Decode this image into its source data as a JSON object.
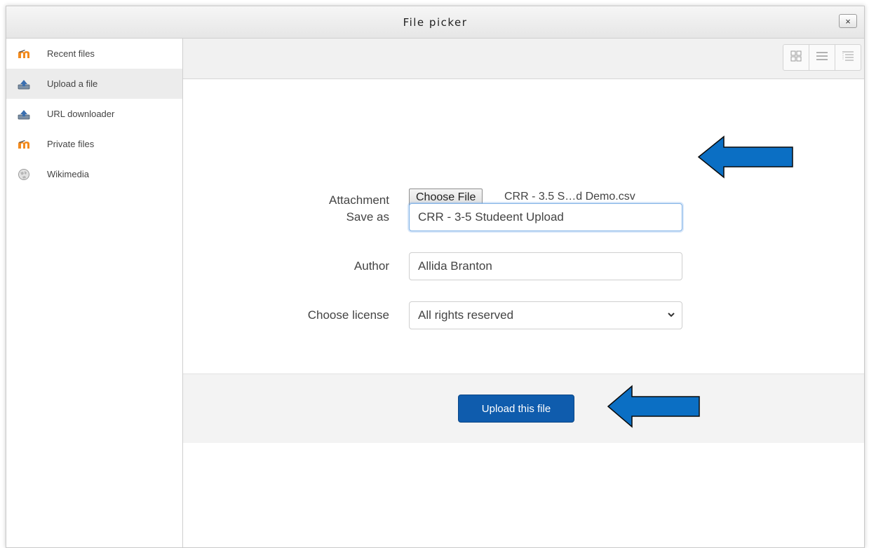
{
  "dialog": {
    "title": "File picker",
    "close_label": "×"
  },
  "sidebar": {
    "items": [
      {
        "label": "Recent files",
        "icon": "moodle-icon",
        "active": false
      },
      {
        "label": "Upload a file",
        "icon": "upload-icon",
        "active": true
      },
      {
        "label": "URL downloader",
        "icon": "url-download-icon",
        "active": false
      },
      {
        "label": "Private files",
        "icon": "moodle-icon",
        "active": false
      },
      {
        "label": "Wikimedia",
        "icon": "wikimedia-globe-icon",
        "active": false
      }
    ]
  },
  "toolbar": {
    "view_buttons": [
      "icon-view-icon",
      "list-view-icon",
      "tree-view-icon"
    ]
  },
  "form": {
    "attachment": {
      "label": "Attachment",
      "button": "Choose File",
      "filename": "CRR - 3.5 S…d Demo.csv"
    },
    "save_as": {
      "label": "Save as",
      "value": "CRR - 3-5 Studeent Upload"
    },
    "author": {
      "label": "Author",
      "value": "Allida Branton"
    },
    "license": {
      "label": "Choose license",
      "selected": "All rights reserved"
    }
  },
  "footer": {
    "upload_label": "Upload this file"
  },
  "colors": {
    "primary_button": "#0f5cad",
    "annotation_arrow": "#0b6fc4"
  }
}
